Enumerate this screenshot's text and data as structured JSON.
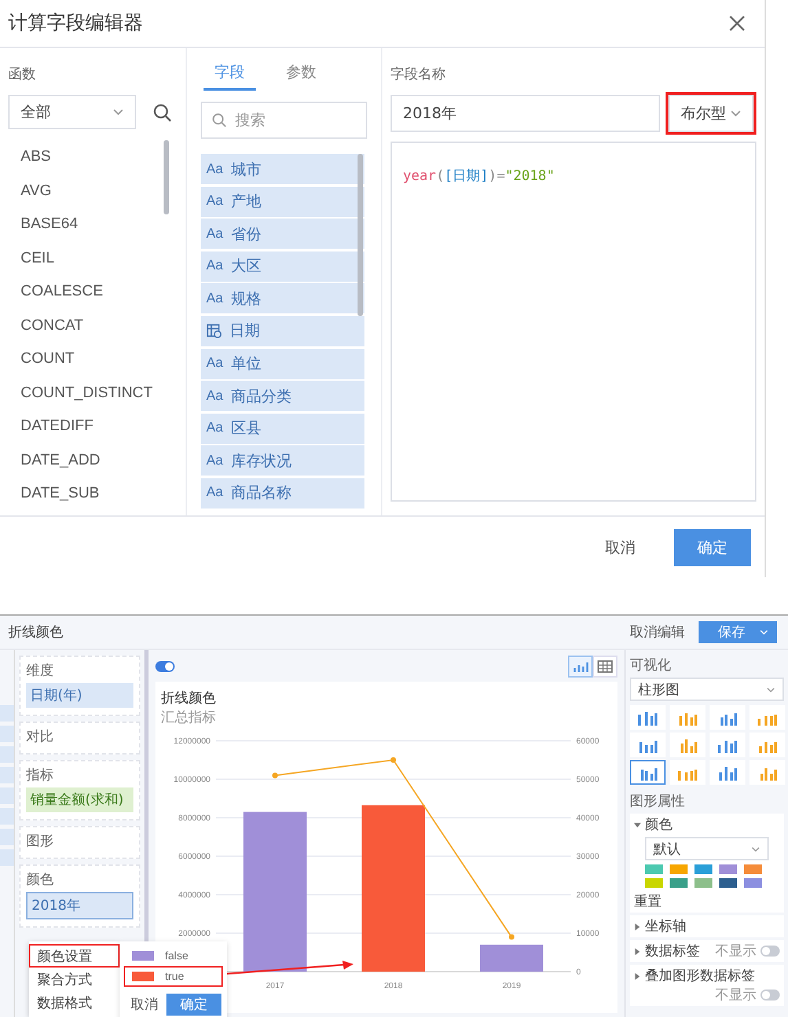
{
  "dialog": {
    "title": "计算字段编辑器",
    "functions": {
      "label": "函数",
      "category": "全部",
      "items": [
        "ABS",
        "AVG",
        "BASE64",
        "CEIL",
        "COALESCE",
        "CONCAT",
        "COUNT",
        "COUNT_DISTINCT",
        "DATEDIFF",
        "DATE_ADD",
        "DATE_SUB"
      ]
    },
    "fields": {
      "tabs": [
        {
          "label": "字段",
          "selected": true
        },
        {
          "label": "参数",
          "selected": false
        }
      ],
      "search": {
        "placeholder": "搜索"
      },
      "items": [
        {
          "kind": "text",
          "icon": "Aa",
          "name": "城市"
        },
        {
          "kind": "text",
          "icon": "Aa",
          "name": "产地"
        },
        {
          "kind": "text",
          "icon": "Aa",
          "name": "省份"
        },
        {
          "kind": "text",
          "icon": "Aa",
          "name": "大区"
        },
        {
          "kind": "text",
          "icon": "Aa",
          "name": "规格"
        },
        {
          "kind": "date",
          "name": "日期"
        },
        {
          "kind": "text",
          "icon": "Aa",
          "name": "单位"
        },
        {
          "kind": "text",
          "icon": "Aa",
          "name": "商品分类"
        },
        {
          "kind": "text",
          "icon": "Aa",
          "name": "区县"
        },
        {
          "kind": "text",
          "icon": "Aa",
          "name": "库存状况"
        },
        {
          "kind": "text",
          "icon": "Aa",
          "name": "商品名称"
        }
      ]
    },
    "editor": {
      "label": "字段名称",
      "name_value": "2018年",
      "type": "布尔型",
      "type_highlighted": true,
      "formula": [
        {
          "kind": "function",
          "text": "year"
        },
        {
          "kind": "punct",
          "text": "("
        },
        {
          "kind": "field",
          "text": "[日期]"
        },
        {
          "kind": "punct",
          "text": ")="
        },
        {
          "kind": "string",
          "text": "\"2018\""
        }
      ]
    },
    "buttons": [
      {
        "kind": "secondary",
        "label": "取消"
      },
      {
        "kind": "primary",
        "label": "确定"
      }
    ]
  },
  "analysis": {
    "breadcrumb": "折线颜色",
    "actions": [
      {
        "kind": "secondary",
        "label": "取消编辑"
      },
      {
        "kind": "primary",
        "label": "保存"
      }
    ],
    "config": [
      {
        "label": "维度",
        "chip": {
          "kind": "dimension",
          "text": "日期(年)"
        }
      },
      {
        "label": "对比"
      },
      {
        "label": "指标",
        "chip": {
          "kind": "measure",
          "text": "销量金额(求和)"
        }
      },
      {
        "label": "图形"
      },
      {
        "label": "颜色",
        "chip": {
          "kind": "color",
          "text": "2018年"
        }
      }
    ],
    "menu": [
      {
        "label": "颜色设置",
        "highlighted": true
      },
      {
        "label": "聚合方式",
        "highlighted": false
      },
      {
        "label": "数据格式",
        "highlighted": false
      }
    ],
    "legend": {
      "items": [
        {
          "label": "false",
          "color": "#a08fd8",
          "highlighted": false
        },
        {
          "label": "true",
          "color": "#f85a3a",
          "highlighted": true
        }
      ],
      "buttons": [
        {
          "kind": "secondary",
          "label": "取消"
        },
        {
          "kind": "primary",
          "label": "确定"
        }
      ]
    },
    "auto_refresh": {
      "on": true
    },
    "chart_title": "折线颜色",
    "chart_subtitle": "汇总指标",
    "chart_data": {
      "type": "bar",
      "categories": [
        "2017",
        "2018",
        "2019"
      ],
      "stacked": true,
      "series": [
        {
          "color": "#a08fd8",
          "values": [
            8300000,
            null,
            1400000
          ]
        },
        {
          "color": "#f85a3a",
          "values": [
            null,
            8650000,
            null
          ]
        },
        {
          "type": "line",
          "axis": "y2",
          "marker": true,
          "color": "#f5a623",
          "values": [
            51000,
            55000,
            9000
          ]
        }
      ],
      "grid": true,
      "ylim": [
        0,
        12000000
      ],
      "yticks": [
        2000000,
        4000000,
        6000000,
        8000000,
        10000000,
        12000000
      ],
      "y2lim": [
        0,
        60000
      ],
      "y2ticks": [
        0,
        10000,
        20000,
        30000,
        40000,
        50000,
        60000
      ]
    },
    "right": {
      "title": "可视化",
      "chart_type": "柱形图",
      "chart_types": [
        {
          "selected": false
        },
        {
          "selected": false
        },
        {
          "selected": false
        },
        {
          "selected": false
        },
        {
          "selected": false
        },
        {
          "selected": false
        },
        {
          "selected": false
        },
        {
          "selected": false
        },
        {
          "selected": true
        },
        {
          "selected": false
        },
        {
          "selected": false
        },
        {
          "selected": false
        }
      ],
      "props_title": "图形属性",
      "color_label": "颜色",
      "color_expanded": true,
      "palette": "默认",
      "swatches": [
        {
          "color": "#4cc9b0"
        },
        {
          "color": "#f7a600"
        },
        {
          "color": "#2a9fd8"
        },
        {
          "color": "#a08fd8"
        },
        {
          "color": "#f58c3a"
        },
        {
          "color": "#c9d600"
        },
        {
          "color": "#3aa08a"
        },
        {
          "color": "#8dbf8b"
        },
        {
          "color": "#2d5f8f"
        },
        {
          "color": "#8c8fe0"
        }
      ],
      "reset": "重置",
      "rows": [
        {
          "label": "坐标轴",
          "expanded": false
        },
        {
          "label": "数据标签",
          "expanded": false,
          "status": "不显示",
          "on": false
        },
        {
          "label": "叠加图形数据标签",
          "expanded": false,
          "status": "不显示",
          "on": false
        }
      ]
    }
  }
}
